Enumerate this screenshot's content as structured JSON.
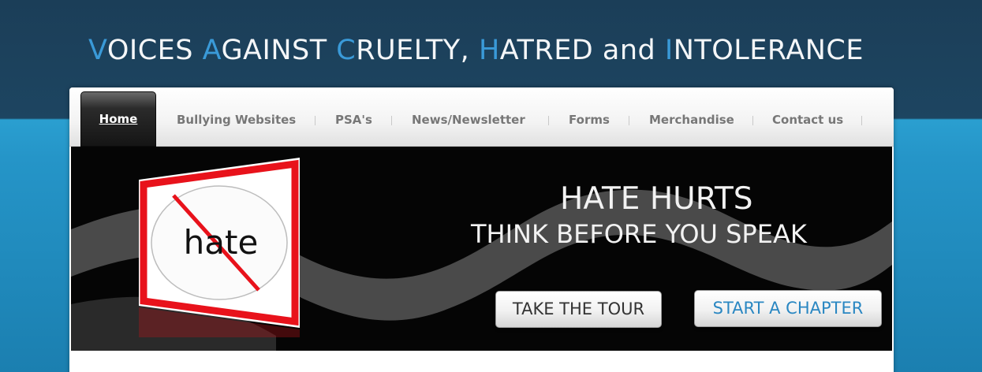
{
  "site": {
    "title_parts": [
      {
        "text": "V",
        "hl": true
      },
      {
        "text": "OICES ",
        "hl": false
      },
      {
        "text": "A",
        "hl": true
      },
      {
        "text": "GAINST ",
        "hl": false
      },
      {
        "text": "C",
        "hl": true
      },
      {
        "text": "RUELTY, ",
        "hl": false
      },
      {
        "text": "H",
        "hl": true
      },
      {
        "text": "ATRED and ",
        "hl": false
      },
      {
        "text": "I",
        "hl": true
      },
      {
        "text": "NTOLERANCE",
        "hl": false
      }
    ]
  },
  "nav": {
    "home": "Home",
    "items": [
      "Bullying Websites",
      "PSA's",
      "News/Newsletter",
      "Forms",
      "Merchandise",
      "Contact us"
    ]
  },
  "banner": {
    "sign_text": "hate",
    "headline1": "HATE HURTS",
    "headline2": "THINK BEFORE YOU SPEAK",
    "tour_button": "TAKE THE TOUR",
    "chapter_button": "START A CHAPTER"
  },
  "colors": {
    "header_bg": "#1d4561",
    "title_accent": "#3a9ad8",
    "chapter_button_text": "#2a87c2",
    "sign_red": "#e8121b"
  }
}
